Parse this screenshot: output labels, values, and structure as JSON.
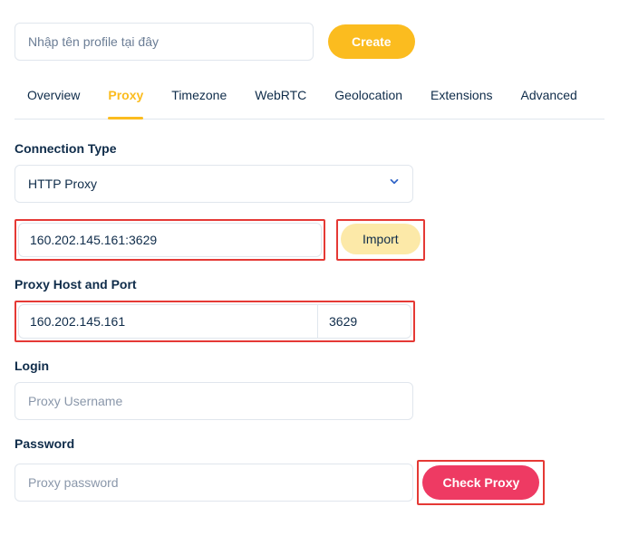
{
  "top": {
    "profile_placeholder": "Nhập tên profile tại đây",
    "create_label": "Create"
  },
  "tabs": [
    {
      "label": "Overview",
      "active": false
    },
    {
      "label": "Proxy",
      "active": true
    },
    {
      "label": "Timezone",
      "active": false
    },
    {
      "label": "WebRTC",
      "active": false
    },
    {
      "label": "Geolocation",
      "active": false
    },
    {
      "label": "Extensions",
      "active": false
    },
    {
      "label": "Advanced",
      "active": false
    }
  ],
  "connection": {
    "label": "Connection Type",
    "selected": "HTTP Proxy"
  },
  "proxy_string": {
    "value": "160.202.145.161:3629",
    "import_label": "Import"
  },
  "host_port": {
    "label": "Proxy Host and Port",
    "host": "160.202.145.161",
    "port": "3629"
  },
  "login": {
    "label": "Login",
    "placeholder": "Proxy Username",
    "value": ""
  },
  "password": {
    "label": "Password",
    "placeholder": "Proxy password",
    "value": ""
  },
  "check_label": "Check Proxy",
  "colors": {
    "accent_yellow": "#fbbc1f",
    "accent_red": "#ee3a63",
    "highlight_border": "#e53935",
    "text_primary": "#0f2c4a"
  }
}
